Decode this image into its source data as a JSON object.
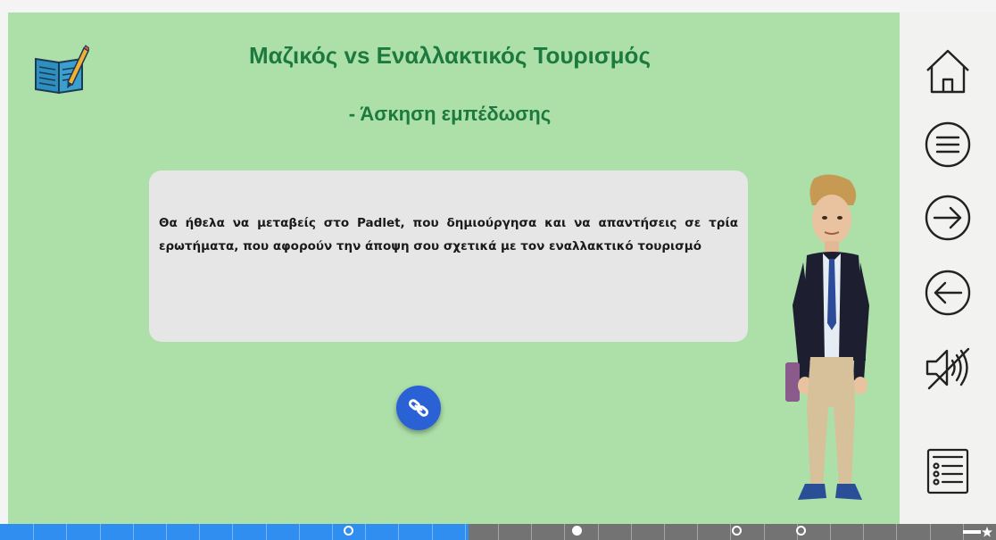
{
  "lesson": {
    "title": "Μαζικός vs Εναλλακτικός Τουρισμός",
    "subtitle": "- Άσκηση εμπέδωσης",
    "instruction": "Θα ήθελα να μεταβείς στο Padlet, που δημιούργησα και να απαντήσεις σε τρία ερωτήματα, που αφορούν την άποψη σου σχετικά με τον εναλλακτικό τουρισμό"
  },
  "colors": {
    "stage_background": "#addfa9",
    "title": "#1c7a3e",
    "link_button": "#2a62d6",
    "progress_done": "#2f8ef0",
    "progress_remaining": "#737373"
  },
  "sidebar": {
    "buttons": [
      {
        "name": "home-button",
        "icon": "home-icon"
      },
      {
        "name": "menu-button",
        "icon": "menu-icon"
      },
      {
        "name": "next-button",
        "icon": "arrow-right-icon"
      },
      {
        "name": "previous-button",
        "icon": "arrow-left-icon"
      },
      {
        "name": "mute-button",
        "icon": "speaker-muted-icon"
      },
      {
        "name": "checklist-button",
        "icon": "checklist-icon"
      }
    ]
  },
  "progress": {
    "fraction_complete": 0.47,
    "segments": 30,
    "markers": [
      {
        "position": 0.35,
        "filled": false
      },
      {
        "position": 0.58,
        "filled": true
      },
      {
        "position": 0.74,
        "filled": false
      },
      {
        "position": 0.805,
        "filled": false
      }
    ],
    "end_icon": "star-icon"
  }
}
